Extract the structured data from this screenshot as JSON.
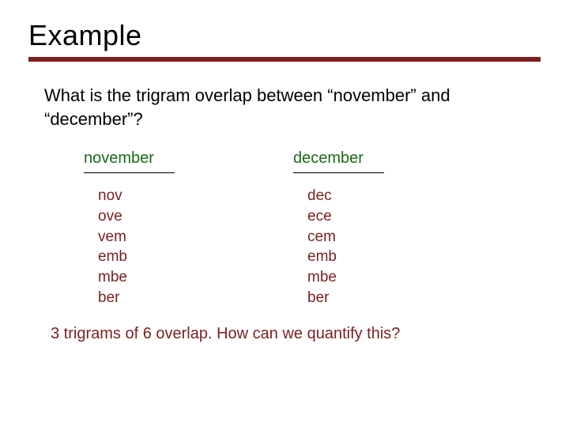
{
  "title": "Example",
  "question": "What is the trigram overlap between “november” and “december”?",
  "columns": [
    {
      "head": "november",
      "trigrams": [
        "nov",
        "ove",
        "vem",
        "emb",
        "mbe",
        "ber"
      ]
    },
    {
      "head": "december",
      "trigrams": [
        "dec",
        "ece",
        "cem",
        "emb",
        "mbe",
        "ber"
      ]
    }
  ],
  "footer": "3 trigrams of 6 overlap.  How can we quantify this?"
}
